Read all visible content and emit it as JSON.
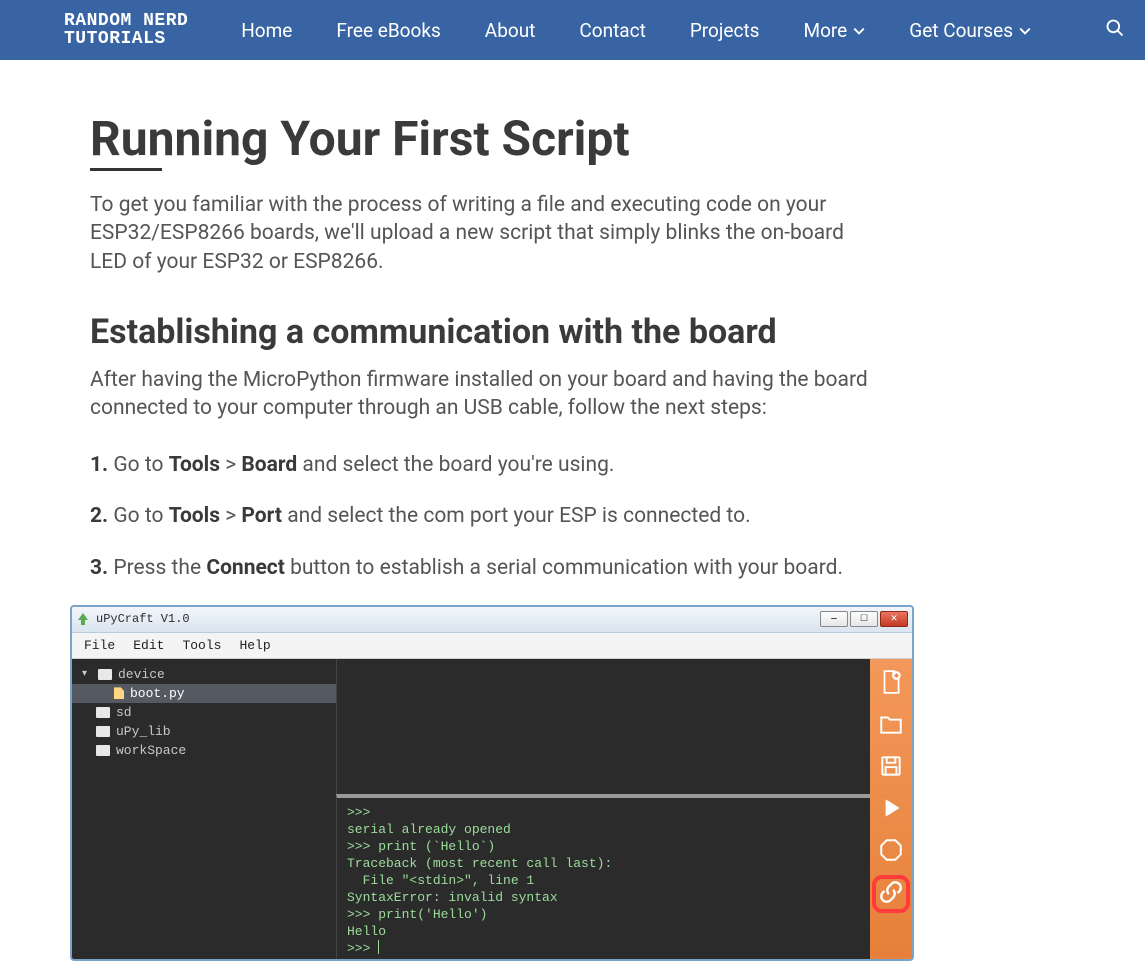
{
  "nav": {
    "brand_line1": "RANDOM NERD",
    "brand_line2": "TUTORIALS",
    "items": [
      "Home",
      "Free eBooks",
      "About",
      "Contact",
      "Projects"
    ],
    "more": "More",
    "courses": "Get Courses"
  },
  "content": {
    "h1": "Running Your First Script",
    "p1": "To get you familiar with the process of writing a file and executing code on your ESP32/ESP8266 boards, we'll upload a new script that simply blinks the on-board LED of your ESP32 or ESP8266.",
    "h2": "Establishing a communication with the board",
    "p2": "After having the MicroPython firmware installed on your board and having the board connected to your computer through an USB cable, follow the next steps:",
    "step1": {
      "num": "1.",
      "pre": " Go to ",
      "tools": "Tools",
      "gt": " > ",
      "target": "Board",
      "post": " and select the board you're using."
    },
    "step2": {
      "num": "2.",
      "pre": " Go to ",
      "tools": "Tools",
      "gt": " > ",
      "target": "Port",
      "post": " and select the com port your ESP is connected to."
    },
    "step3": {
      "num": "3.",
      "pre": " Press the ",
      "btn": "Connect",
      "post": " button to establish a serial communication with your board."
    }
  },
  "ide": {
    "title": "uPyCraft V1.0",
    "menus": [
      "File",
      "Edit",
      "Tools",
      "Help"
    ],
    "tree": {
      "device": "device",
      "boot": "boot.py",
      "sd": "sd",
      "upylib": "uPy_lib",
      "workspace": "workSpace"
    },
    "repl": ">>>\nserial already opened\n>>> print (`Hello`)\nTraceback (most recent call last):\n  File \"<stdin>\", line 1\nSyntaxError: invalid syntax\n>>> print('Hello')\nHello\n>>> "
  }
}
